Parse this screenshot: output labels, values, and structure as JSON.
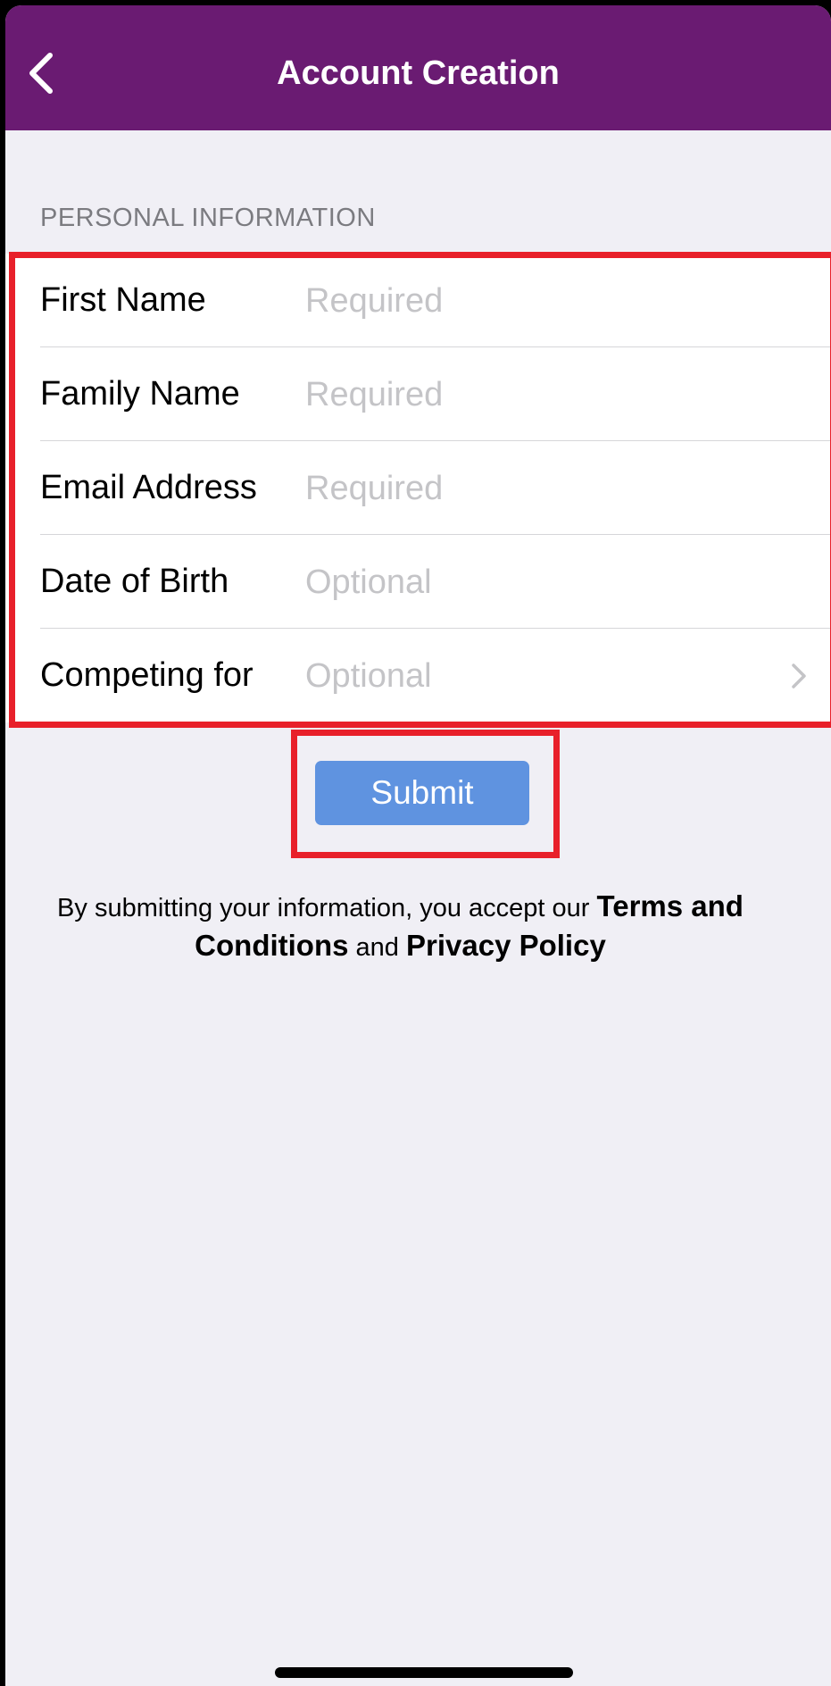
{
  "nav": {
    "title": "Account Creation",
    "back_icon": "chevron-left-icon"
  },
  "form": {
    "section_header": "PERSONAL INFORMATION",
    "fields": [
      {
        "label": "First Name",
        "placeholder": "Required",
        "value": ""
      },
      {
        "label": "Family Name",
        "placeholder": "Required",
        "value": ""
      },
      {
        "label": "Email Address",
        "placeholder": "Required",
        "value": ""
      },
      {
        "label": "Date of Birth",
        "placeholder": "Optional",
        "value": ""
      },
      {
        "label": "Competing for",
        "placeholder": "Optional",
        "value": "",
        "icon": "chevron-right-icon"
      }
    ]
  },
  "submit": {
    "label": "Submit"
  },
  "terms": {
    "prefix": "By submitting your information, you accept our ",
    "terms_link": "Terms and Conditions",
    "conjunction": " and ",
    "privacy_link": "Privacy Policy"
  },
  "colors": {
    "navbar": "#6a1b72",
    "background": "#f0eff5",
    "submit_button": "#5f93e0",
    "highlight": "#e8202a",
    "placeholder": "#c4c4c7"
  }
}
